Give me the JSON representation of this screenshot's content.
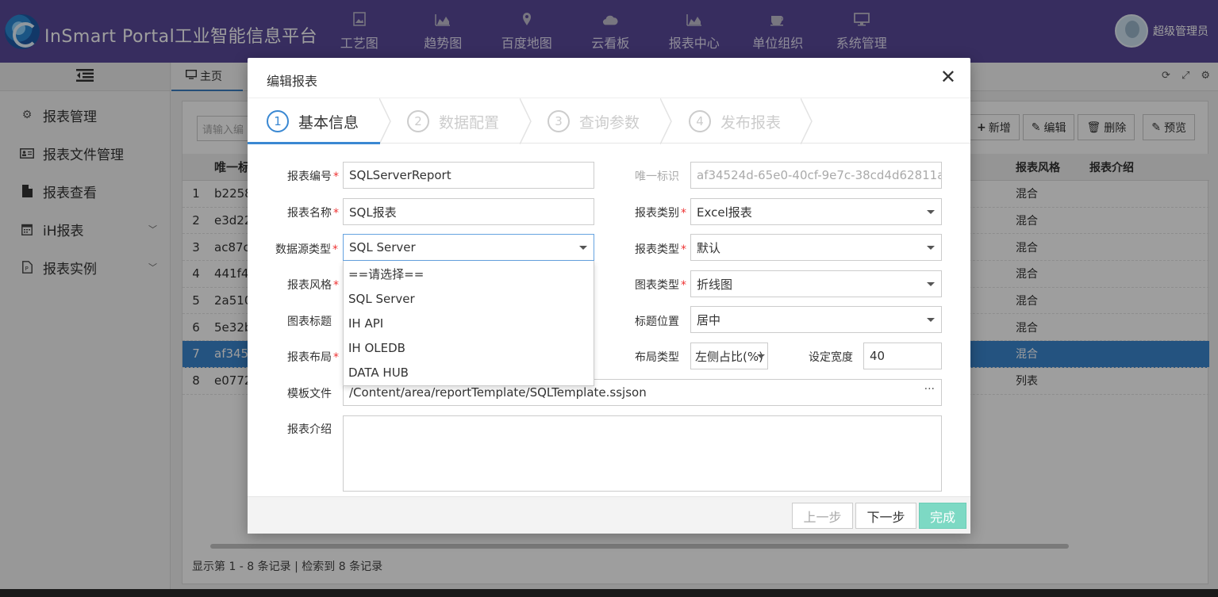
{
  "app": {
    "title": "InSmart Portal工业智能信息平台",
    "user": "超级管理员"
  },
  "nav": [
    {
      "label": "工艺图",
      "icon": "image-icon"
    },
    {
      "label": "趋势图",
      "icon": "area-chart-icon"
    },
    {
      "label": "百度地图",
      "icon": "map-marker-icon"
    },
    {
      "label": "云看板",
      "icon": "cloud-icon"
    },
    {
      "label": "报表中心",
      "icon": "area-chart-icon"
    },
    {
      "label": "单位组织",
      "icon": "coffee-icon"
    },
    {
      "label": "系统管理",
      "icon": "monitor-icon"
    }
  ],
  "sidebar": {
    "items": [
      {
        "label": "报表管理",
        "icon": "gears-icon"
      },
      {
        "label": "报表文件管理",
        "icon": "id-card-icon"
      },
      {
        "label": "报表查看",
        "icon": "file-icon"
      },
      {
        "label": "iH报表",
        "icon": "calendar-icon"
      },
      {
        "label": "报表实例",
        "icon": "file-report-icon"
      }
    ]
  },
  "tabs": {
    "home": "主页"
  },
  "list": {
    "search_placeholder": "请输入编",
    "buttons": {
      "add": "新增",
      "edit": "编辑",
      "delete": "删除",
      "preview": "预览"
    },
    "headers": {
      "id": "唯一标",
      "style": "报表风格",
      "intro": "报表介绍"
    },
    "rows": [
      {
        "num": "1",
        "id": "b2258",
        "style": "混合"
      },
      {
        "num": "2",
        "id": "e3d22",
        "style": "混合"
      },
      {
        "num": "3",
        "id": "ac87c",
        "style": "混合"
      },
      {
        "num": "4",
        "id": "441f4",
        "style": "混合"
      },
      {
        "num": "5",
        "id": "2a510",
        "style": "混合"
      },
      {
        "num": "6",
        "id": "5e32b",
        "style": "混合"
      },
      {
        "num": "7",
        "id": "af345",
        "style": "混合",
        "selected": true
      },
      {
        "num": "8",
        "id": "e0772",
        "style": "列表"
      }
    ],
    "footer": "显示第 1 - 8 条记录 | 检索到 8 条记录"
  },
  "modal": {
    "title": "编辑报表",
    "steps": [
      {
        "num": "1",
        "label": "基本信息",
        "active": true
      },
      {
        "num": "2",
        "label": "数据配置"
      },
      {
        "num": "3",
        "label": "查询参数"
      },
      {
        "num": "4",
        "label": "发布报表"
      }
    ],
    "fields": {
      "report_code": {
        "label": "报表编号",
        "value": "SQLServerReport"
      },
      "unique_id": {
        "label": "唯一标识",
        "value": "af34524d-65e0-40cf-9e7c-38cd4d62811a"
      },
      "report_name": {
        "label": "报表名称",
        "value": "SQL报表"
      },
      "report_category": {
        "label": "报表类别",
        "value": "Excel报表"
      },
      "datasource_type": {
        "label": "数据源类型",
        "value": "SQL Server"
      },
      "report_type": {
        "label": "报表类型",
        "value": "默认"
      },
      "report_style": {
        "label": "报表风格"
      },
      "chart_type": {
        "label": "图表类型",
        "value": "折线图"
      },
      "chart_title": {
        "label": "图表标题"
      },
      "title_position": {
        "label": "标题位置",
        "value": "居中"
      },
      "report_layout": {
        "label": "报表布局"
      },
      "layout_type": {
        "label": "布局类型",
        "value": "左侧占比(%)"
      },
      "set_width": {
        "label": "设定宽度",
        "value": "40"
      },
      "template_file": {
        "label": "模板文件",
        "value": "/Content/area/reportTemplate/SQLTemplate.ssjson"
      },
      "report_intro": {
        "label": "报表介绍"
      }
    },
    "dropdown_options": [
      "==请选择==",
      "SQL Server",
      "IH API",
      "IH OLEDB",
      "DATA HUB"
    ],
    "buttons": {
      "prev": "上一步",
      "next": "下一步",
      "finish": "完成"
    }
  }
}
